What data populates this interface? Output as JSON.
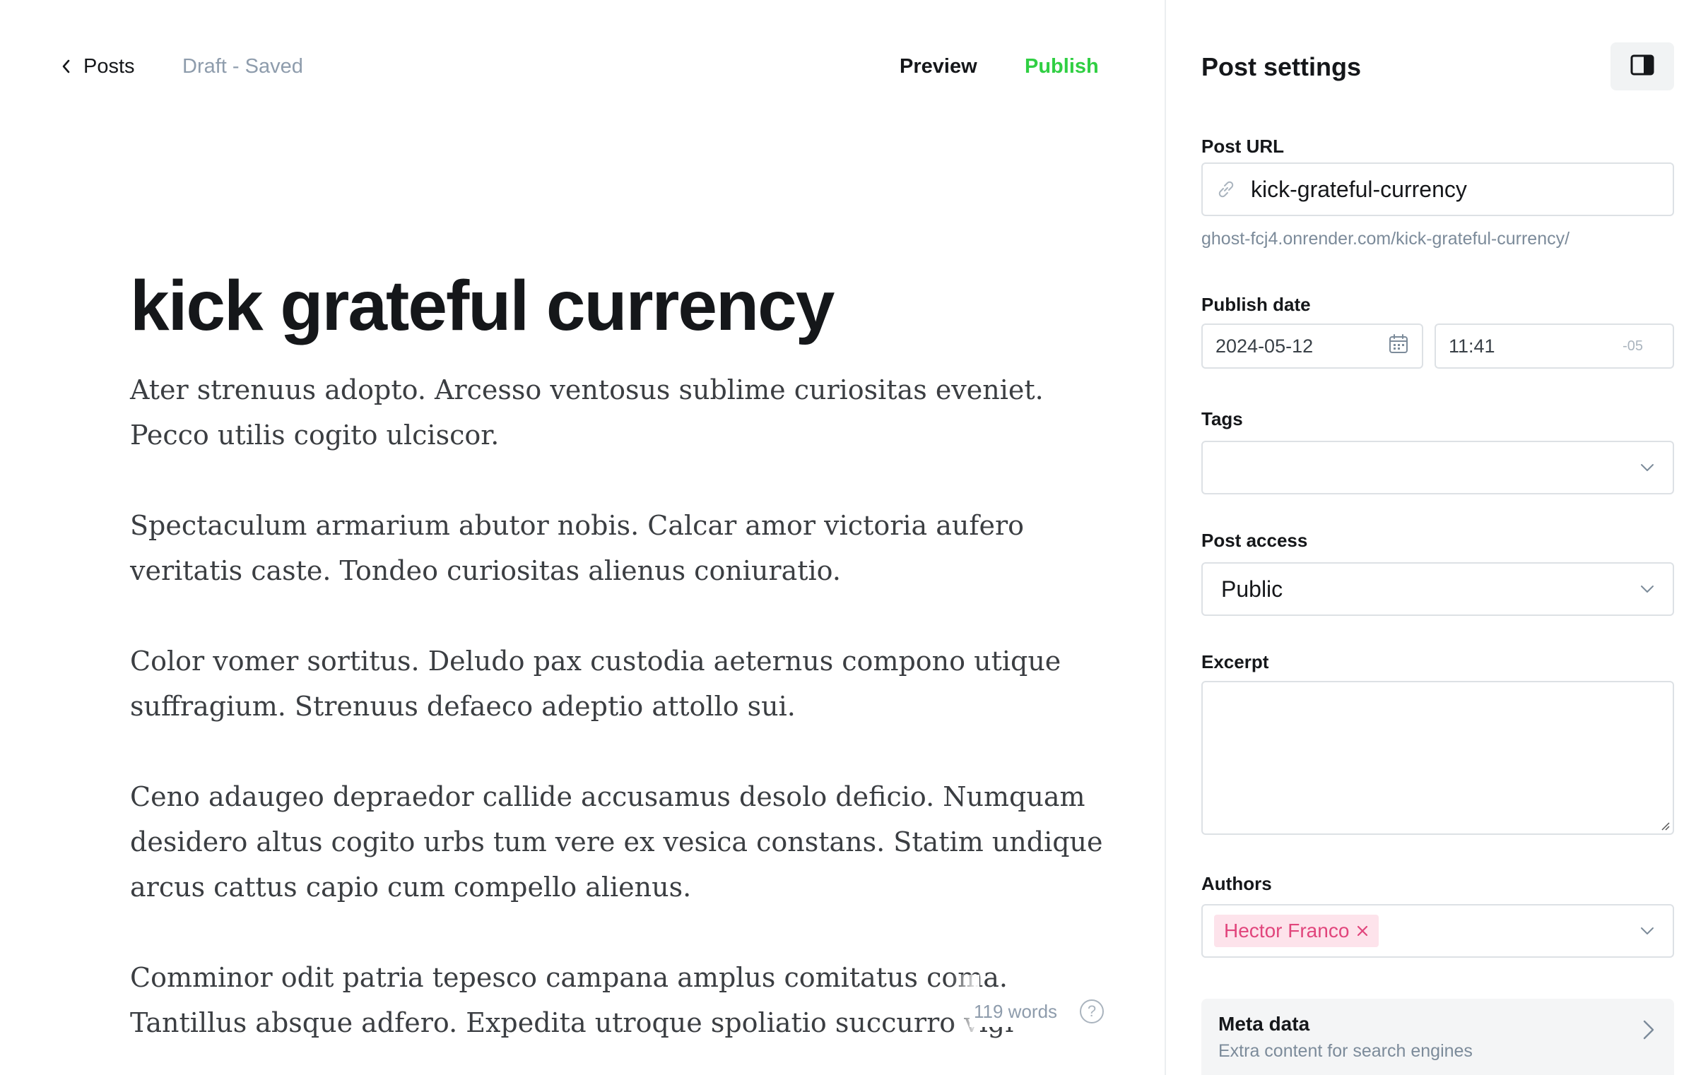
{
  "header": {
    "back_label": "Posts",
    "status": "Draft - Saved",
    "preview_label": "Preview",
    "publish_label": "Publish"
  },
  "post": {
    "title": "kick grateful currency",
    "paragraphs": [
      [
        "Ater strenuus adopto. Arcesso ventosus sublime curiositas eveniet.",
        "Pecco utilis cogito ulciscor."
      ],
      [
        "Spectaculum armarium abutor nobis. Calcar amor victoria aufero",
        "veritatis caste. Tondeo curiositas alienus coniuratio."
      ],
      [
        "Color vomer sortitus. Deludo pax custodia aeternus compono utique",
        "suffragium. Strenuus defaeco adeptio attollo sui."
      ],
      [
        "Ceno adaugeo depraedor callide accusamus desolo deficio. Numquam",
        "desidero altus cogito urbs tum vere ex vesica constans. Statim undique",
        "arcus cattus capio cum compello alienus."
      ],
      [
        "Comminor odit patria tepesco campana amplus comitatus coma.",
        "Tantillus absque adfero. Expedita utroque spoliatio succurro vigi"
      ]
    ],
    "word_count": "119 words",
    "help_glyph": "?"
  },
  "sidebar": {
    "title": "Post settings",
    "toggle_icon": "sidebar-panel-icon",
    "post_url": {
      "label": "Post URL",
      "value": "kick-grateful-currency",
      "icon": "link-icon",
      "hint": "ghost-fcj4.onrender.com/kick-grateful-currency/"
    },
    "publish_date": {
      "label": "Publish date",
      "date": "2024-05-12",
      "date_icon": "calendar-icon",
      "time": "11:41",
      "timezone": "-05"
    },
    "tags": {
      "label": "Tags",
      "value": ""
    },
    "post_access": {
      "label": "Post access",
      "value": "Public"
    },
    "excerpt": {
      "label": "Excerpt",
      "value": ""
    },
    "authors": {
      "label": "Authors",
      "chips": [
        "Hector Franco"
      ]
    },
    "meta_data": {
      "title": "Meta data",
      "subtitle": "Extra content for search engines"
    }
  },
  "colors": {
    "accent_green": "#30cf43",
    "author_chip_bg": "#fde3eb",
    "author_chip_text": "#e1457c",
    "muted_text": "#8e9cac",
    "border": "#dde1e5"
  }
}
